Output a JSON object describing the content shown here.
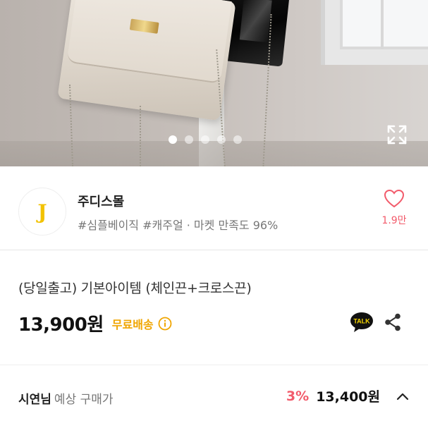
{
  "gallery": {
    "total_images": 5,
    "current_index": 1
  },
  "shop": {
    "logo_letter": "J",
    "name": "주디스몰",
    "tags": "#심플베이직 #캐주얼 · 마켓 만족도 96%",
    "like_count": "1.9만"
  },
  "product": {
    "title": "(당일출고) 기본아이템 (체인끈+크로스끈)",
    "price": "13,900원",
    "shipping": "무료배송",
    "talk_label": "TALK"
  },
  "expected": {
    "user_name": "시연님",
    "label": "예상 구매가",
    "discount_rate": "3%",
    "price": "13,400원"
  },
  "colors": {
    "accent_pink": "#f25b6b",
    "shipping_orange": "#f0a500",
    "logo_yellow": "#f2c200"
  }
}
